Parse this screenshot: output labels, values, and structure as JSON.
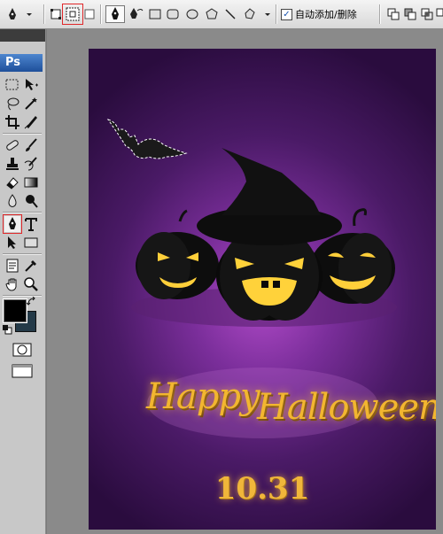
{
  "options_bar": {
    "auto_add_label": "自动添加/删除",
    "auto_add_checked": true,
    "checkmark": "✓"
  },
  "toolbox": {
    "logo": "Ps",
    "foreground_color": "#000000",
    "background_color": "#243a48"
  },
  "artwork": {
    "greeting_word1": "Happy",
    "greeting_word2": "Halloween",
    "date": "10.31",
    "colors": {
      "background_center": "#b04ac8",
      "background_edge": "#2a0c3e",
      "text_gold": "#f2b630",
      "pumpkin_glow": "#ffd23a"
    }
  },
  "icons": [
    "pen-tool-icon",
    "shape-layers-icon",
    "paths-icon",
    "fill-pixels-icon",
    "pen-icon",
    "freeform-pen-icon",
    "rectangle-icon",
    "rounded-rectangle-icon",
    "ellipse-icon",
    "polygon-icon",
    "line-icon",
    "custom-shape-icon"
  ]
}
